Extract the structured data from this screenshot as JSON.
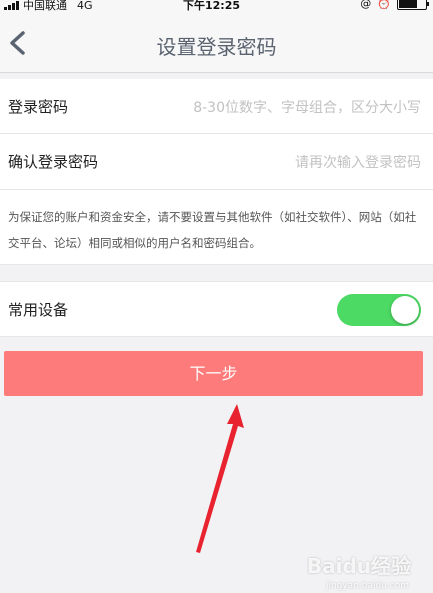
{
  "status_bar": {
    "carrier": "中国联通",
    "network": "4G",
    "time": "下午12:25"
  },
  "header": {
    "title": "设置登录密码"
  },
  "form": {
    "password": {
      "label": "登录密码",
      "placeholder": "8-30位数字、字母组合，区分大小写"
    },
    "confirm": {
      "label": "确认登录密码",
      "placeholder": "请再次输入登录密码"
    },
    "notice": "为保证您的账户和资金安全，请不要设置与其他软件（如社交软件）、网站（如社交平台、论坛）相同或相似的用户名和密码组合。"
  },
  "device": {
    "label": "常用设备",
    "toggle_on": true
  },
  "actions": {
    "next_label": "下一步"
  },
  "colors": {
    "accent": "#fe7b7b",
    "toggle_on": "#4cd964"
  },
  "watermark": {
    "brand": "Baidu经验",
    "url": "jingyan.baidu.com"
  }
}
